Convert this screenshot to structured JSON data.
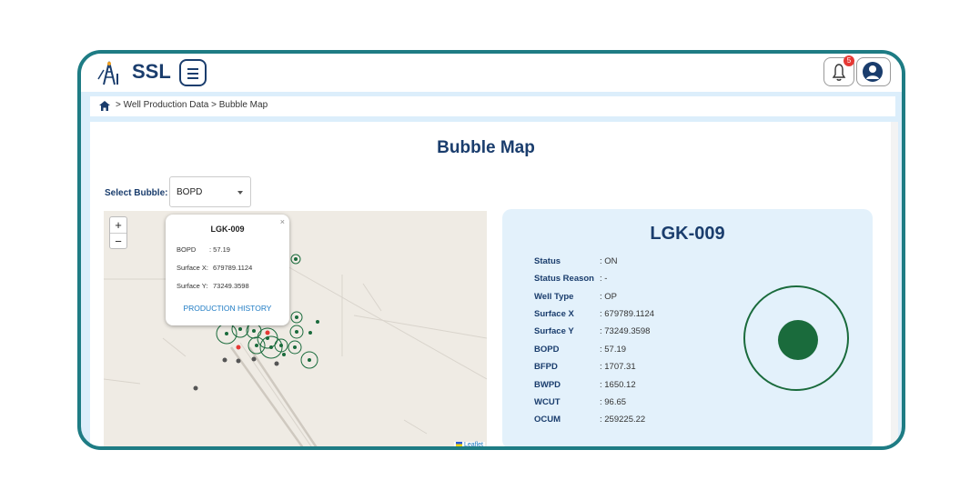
{
  "header": {
    "brand": "SSL",
    "notification_count": "5"
  },
  "breadcrumb": {
    "text": "> Well Production Data > Bubble Map"
  },
  "page": {
    "title": "Bubble Map"
  },
  "filter": {
    "label": "Select Bubble:",
    "selected": "BOPD"
  },
  "map": {
    "zoom_in": "+",
    "zoom_out": "−",
    "attribution": "Leaflet",
    "popup": {
      "close": "×",
      "title": "LGK-009",
      "rows": [
        {
          "label": "BOPD",
          "value": ": 57.19"
        },
        {
          "label": "Surface X:",
          "value": "679789.1124"
        },
        {
          "label": "Surface Y:",
          "value": "73249.3598"
        }
      ],
      "link": "PRODUCTION HISTORY"
    }
  },
  "details": {
    "well": "LGK-009",
    "rows": [
      {
        "label": "Status",
        "value": ": ON"
      },
      {
        "label": "Status Reason",
        "value": ": -"
      },
      {
        "label": "Well Type",
        "value": ": OP"
      },
      {
        "label": "Surface X",
        "value": ": 679789.1124"
      },
      {
        "label": "Surface Y",
        "value": ": 73249.3598"
      },
      {
        "label": "BOPD",
        "value": ": 57.19"
      },
      {
        "label": "BFPD",
        "value": ": 1707.31"
      },
      {
        "label": "BWPD",
        "value": ": 1650.12"
      },
      {
        "label": "WCUT",
        "value": ": 96.65"
      },
      {
        "label": "OCUM",
        "value": ": 259225.22"
      }
    ]
  },
  "colors": {
    "primary": "#1a3d6d",
    "frame": "#1e7c84",
    "producing_well": "#1a6b3c",
    "alert_well": "#e53935",
    "inactive_well": "#555555",
    "link": "#1e7bc4"
  }
}
